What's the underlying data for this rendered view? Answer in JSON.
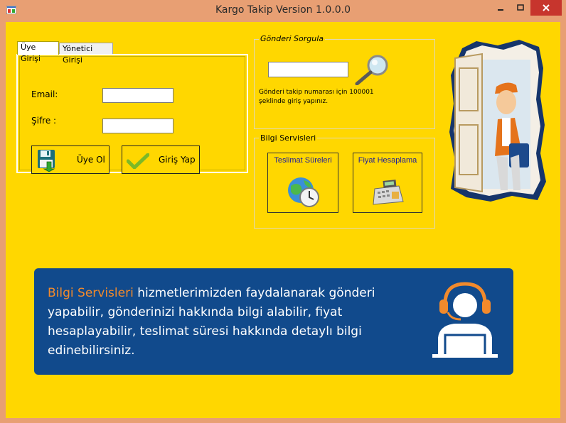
{
  "window": {
    "title": "Kargo Takip Version 1.0.0.0"
  },
  "tabs": [
    {
      "label": "Üye Girişi"
    },
    {
      "label": "Yönetici Girişi"
    }
  ],
  "login": {
    "email_label": "Email:",
    "email_value": "",
    "password_label": "Şifre :",
    "password_value": "",
    "register_label": "Üye Ol",
    "login_label": "Giriş Yap"
  },
  "tracking": {
    "group_title": "Gönderi Sorgula",
    "input_value": "",
    "hint": "Gönderi takip numarası için 100001 şeklinde giriş yapınız."
  },
  "info_services": {
    "group_title": "Bilgi Servisleri",
    "delivery_times_label": "Teslimat Süreleri",
    "price_calc_label": "Fiyat Hesaplama"
  },
  "banner": {
    "highlight": "Bilgi Servisleri",
    "text": " hizmetlerimizden faydalanarak gönderi yapabilir, gönderinizi hakkında bilgi alabilir, fiyat hesaplayabilir, teslimat süresi hakkında detaylı bilgi edinebilirsiniz."
  },
  "colors": {
    "form_bg": "#ffd700",
    "titlebar_bg": "#e89f73",
    "banner_bg": "#114a8c",
    "banner_highlight": "#f28a2c"
  }
}
